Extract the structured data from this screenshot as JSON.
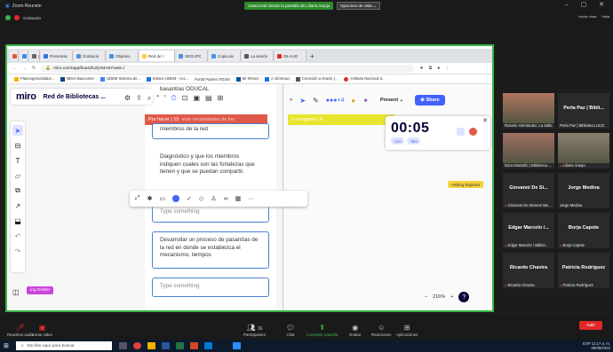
{
  "zoom": {
    "title": "Zoom Reunión",
    "recording_label": "Grabando",
    "share_banner": "Usted está viendo la pantalla de Liliana Araujo",
    "view_options": "Opciones de vista",
    "view_buttons": [
      "Iniciar vista",
      "Vista"
    ]
  },
  "browser": {
    "tabs": [
      {
        "label": "",
        "color": "#4285f4"
      },
      {
        "label": "",
        "color": "#4285f4"
      },
      {
        "label": "(",
        "color": "#555555"
      },
      {
        "label": "Presentac",
        "color": "#3a6ee8"
      },
      {
        "label": "Grabació",
        "color": "#4a90e2"
      },
      {
        "label": "Objetivo",
        "color": "#4a90e2"
      },
      {
        "label": "Red de l",
        "color": "#f5d23a"
      },
      {
        "label": "SEGUPC",
        "color": "#4a90e2"
      },
      {
        "label": "Copia de",
        "color": "#4a90e2"
      },
      {
        "label": "La sesión",
        "color": "#555555"
      },
      {
        "label": "09-AUG",
        "color": "#d93025"
      }
    ],
    "url": "miro.com/app/board/uXjVMA8Ywa0=/",
    "bookmarks": [
      {
        "label": "Planeegresoslabor...",
        "color": "#f4b400"
      },
      {
        "label": "BBVA Bancomer",
        "color": "#004481"
      },
      {
        "label": "UDEM Sistema de...",
        "color": "#4285f4"
      },
      {
        "label": "Enlace UDEM - Acc...",
        "color": "#1a73e8"
      },
      {
        "label": "Portal Padres ITESM",
        "color": "#333333"
      },
      {
        "label": "Mi Telmex",
        "color": "#0055a5"
      },
      {
        "label": "e informaci",
        "color": "#1a73e8"
      },
      {
        "label": "Conexión a Oracle |...",
        "color": "#555555"
      },
      {
        "label": "Instituto Nacional d...",
        "color": "#d93025"
      }
    ]
  },
  "miro": {
    "logo": "miro",
    "board_title": "Red de Bibliotecas ...",
    "column_todo": "Por hacer  |  15",
    "column_todo_overlay": "ecer necesidades de los",
    "column_inprogress": "In progress  |  0",
    "cards": [
      {
        "text": "basantías ODUCAL"
      },
      {
        "text": "miembros de la red"
      },
      {
        "text": "Diagnóstico y que los miembros indiquen cuales son las fortalezas que tienen y que se puedan compartir."
      },
      {
        "text": "Type something",
        "placeholder": true
      },
      {
        "text": "Desarrollar un proceso de pasantías de la red en donde se establezca el mecanismo, tiempos"
      },
      {
        "text": "Type something",
        "placeholder": true
      }
    ],
    "timer": {
      "value": "00:05",
      "plus1": "+1m",
      "plus5": "+5m"
    },
    "present_label": "Present",
    "share_label": "Share",
    "visitor_label": "Visiting Explorer",
    "drafter_label": "ing Drafter",
    "zoom_level": "216%"
  },
  "participants": [
    {
      "name": "Rosario Hernández, La Salle",
      "big": "",
      "photo": true,
      "mic_off": false,
      "photo_color": "#b07860"
    },
    {
      "name": "Perla Paz | Biblioteca UCO",
      "big": "Perla Paz | Bibli...",
      "photo": false,
      "mic_off": false
    },
    {
      "name": "Dora Montaño | Biblioteca ...",
      "big": "",
      "photo": true,
      "mic_off": false,
      "photo_color": "#a07060"
    },
    {
      "name": "Liliana Araujo",
      "big": "",
      "photo": true,
      "mic_off": true,
      "photo_color": "#8a8070"
    },
    {
      "name": "Giovanni De Simone Me...",
      "big": "Giovanni De Si...",
      "photo": false,
      "mic_off": true
    },
    {
      "name": "Jorge Medina",
      "big": "Jorge Medina",
      "photo": false,
      "mic_off": false
    },
    {
      "name": "Edgar Marcelo / Bibliot...",
      "big": "Edgar Marcelo /...",
      "photo": false,
      "mic_off": true
    },
    {
      "name": "Borja Capote",
      "big": "Borja Capote",
      "photo": false,
      "mic_off": true
    },
    {
      "name": "Ricardo Chavira",
      "big": "Ricardo Chavira",
      "photo": false,
      "mic_off": true
    },
    {
      "name": "Patricia Rodríguez",
      "big": "Patricia Rodríguez",
      "photo": false,
      "mic_off": true
    }
  ],
  "controls": {
    "audio": "Reactivar audio",
    "video": "Iniciar video",
    "participants": "Participantes",
    "participants_count": "16",
    "chat": "Chat",
    "share": "Compartir pantalla",
    "record": "Grabar",
    "reactions": "Reacciones",
    "apps": "Aplicaciones",
    "leave": "Salir"
  },
  "taskbar": {
    "search": "Escribe aquí para buscar",
    "lang": "ESP",
    "time": "11:17 a. m.",
    "date": "09/08/2022"
  }
}
